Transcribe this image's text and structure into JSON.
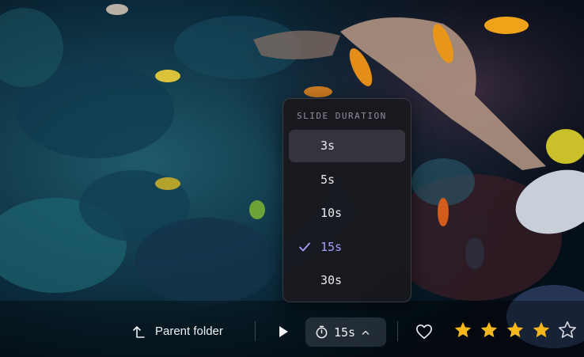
{
  "slide_duration_menu": {
    "header": "SLIDE DURATION",
    "options": [
      {
        "label": "3s",
        "state": "hover"
      },
      {
        "label": "5s",
        "state": ""
      },
      {
        "label": "10s",
        "state": ""
      },
      {
        "label": "15s",
        "state": "selected"
      },
      {
        "label": "30s",
        "state": ""
      }
    ],
    "selected_value": "15s"
  },
  "toolbar": {
    "parent_folder_label": "Parent folder",
    "duration_label": "15s",
    "icons": [
      "arrow-up-left-icon",
      "play-icon",
      "timer-icon",
      "chevron-up-icon",
      "heart-icon",
      "star-icon"
    ],
    "rating": {
      "value": 4,
      "max": 5
    }
  },
  "colors": {
    "accent": "#a99cff",
    "star_filled": "#f4b81c",
    "menu_bg": "#18181e"
  }
}
